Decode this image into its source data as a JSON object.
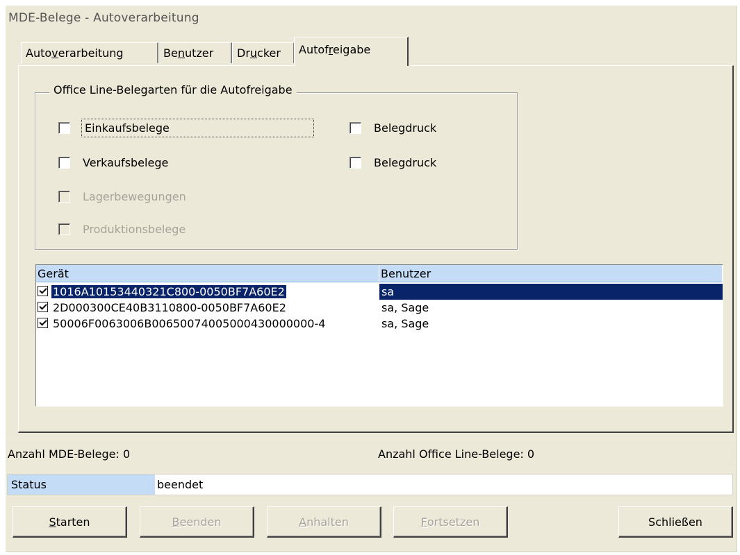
{
  "window": {
    "title": "MDE-Belege - Autoverarbeitung"
  },
  "tabs": [
    {
      "pre": "Auto",
      "u": "v",
      "post": "erarbeitung"
    },
    {
      "pre": "Be",
      "u": "n",
      "post": "utzer"
    },
    {
      "pre": "Dr",
      "u": "u",
      "post": "cker"
    },
    {
      "pre": "Autof",
      "u": "r",
      "post": "eigabe"
    }
  ],
  "group": {
    "title": "Office Line-Belegarten für die Autofreigabe",
    "items": [
      {
        "label": "Einkaufsbelege",
        "checked": false,
        "enabled": true,
        "print_label": "Belegdruck"
      },
      {
        "label": "Verkaufsbelege",
        "checked": false,
        "enabled": true,
        "print_label": "Belegdruck"
      },
      {
        "label": "Lagerbewegungen",
        "checked": false,
        "enabled": false
      },
      {
        "label": "Produktionsbelege",
        "checked": false,
        "enabled": false
      }
    ]
  },
  "devices": {
    "columns": [
      "Gerät",
      "Benutzer"
    ],
    "rows": [
      {
        "device": "1016A10153440321C800-0050BF7A60E2",
        "user": "sa",
        "checked": true,
        "selected": true
      },
      {
        "device": "2D000300CE40B3110800-0050BF7A60E2",
        "user": "sa, Sage",
        "checked": true,
        "selected": false
      },
      {
        "device": "50006F0063006B00650074005000430000000-4",
        "user": "sa, Sage",
        "checked": true,
        "selected": false
      }
    ]
  },
  "info": {
    "mde_count": "Anzahl MDE-Belege: 0",
    "ol_count": "Anzahl Office Line-Belege: 0"
  },
  "status": {
    "label": "Status",
    "value": "beendet"
  },
  "buttons": {
    "start": {
      "u": "S",
      "rest": "tarten"
    },
    "stop": {
      "u": "B",
      "rest": "eenden"
    },
    "pause": {
      "u": "A",
      "rest": "nhalten"
    },
    "resume": {
      "u": "F",
      "rest": "ortsetzen"
    },
    "close": "Schließen"
  }
}
